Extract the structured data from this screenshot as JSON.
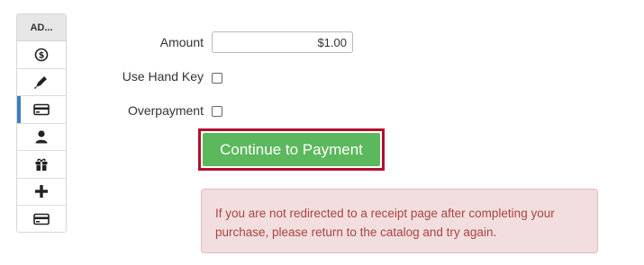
{
  "sidebar": {
    "header": "AD...",
    "items": [
      {
        "icon": "dollar-circle-icon"
      },
      {
        "icon": "pen-icon"
      },
      {
        "icon": "credit-card-icon",
        "active": true
      },
      {
        "icon": "user-icon"
      },
      {
        "icon": "gift-icon"
      },
      {
        "icon": "plus-icon"
      },
      {
        "icon": "credit-card-icon"
      }
    ]
  },
  "form": {
    "amount_label": "Amount",
    "amount_value": "$1.00",
    "hand_key_label": "Use Hand Key",
    "hand_key_checked": false,
    "overpayment_label": "Overpayment",
    "overpayment_checked": false,
    "continue_label": "Continue to Payment"
  },
  "alert": {
    "message": "If you are not redirected to a receipt page after completing your purchase, please return to the catalog and try again."
  },
  "colors": {
    "button_green": "#5cb85c",
    "focus_frame": "#b30f2e",
    "alert_bg": "#f2dede",
    "alert_text": "#a94442",
    "active_marker": "#3a7fc1"
  }
}
